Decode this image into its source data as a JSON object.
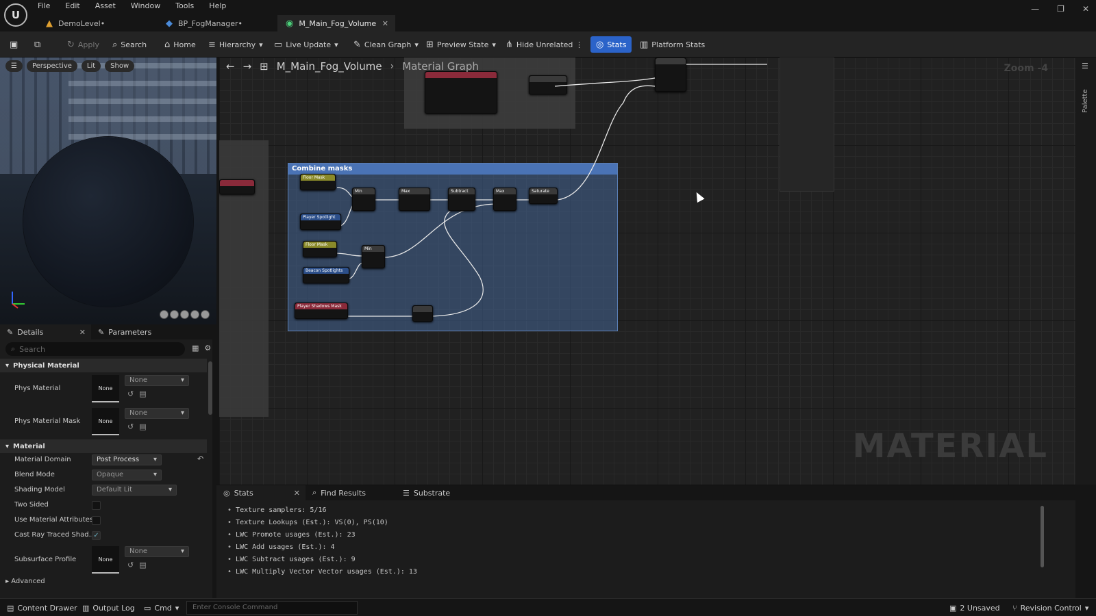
{
  "menu": [
    "File",
    "Edit",
    "Asset",
    "Window",
    "Tools",
    "Help"
  ],
  "tabs": [
    {
      "label": "DemoLevel•",
      "icon": "level-icon"
    },
    {
      "label": "BP_FogManager•",
      "icon": "blueprint-icon"
    },
    {
      "label": "M_Main_Fog_Volume",
      "icon": "material-icon"
    }
  ],
  "toolbar": {
    "apply": "Apply",
    "search": "Search",
    "home": "Home",
    "hierarchy": "Hierarchy",
    "live_update": "Live Update",
    "clean_graph": "Clean Graph",
    "preview_state": "Preview State",
    "hide_unrelated": "Hide Unrelated",
    "stats": "Stats",
    "platform_stats": "Platform Stats"
  },
  "viewport": {
    "perspective": "Perspective",
    "lit": "Lit",
    "show": "Show"
  },
  "details": {
    "tab_details": "Details",
    "tab_parameters": "Parameters",
    "search_placeholder": "Search",
    "section_physical": "Physical Material",
    "section_material": "Material",
    "advanced": "Advanced",
    "phys_material": "Phys Material",
    "phys_material_mask": "Phys Material Mask",
    "none": "None",
    "material_domain": "Material Domain",
    "material_domain_value": "Post Process",
    "blend_mode": "Blend Mode",
    "blend_mode_value": "Opaque",
    "shading_model": "Shading Model",
    "shading_model_value": "Default Lit",
    "two_sided": "Two Sided",
    "use_material_attributes": "Use Material Attributes",
    "cast_ray": "Cast Ray Traced Shad...",
    "subsurface_profile": "Subsurface Profile"
  },
  "graph": {
    "breadcrumb_asset": "M_Main_Fog_Volume",
    "breadcrumb_graph": "Material Graph",
    "zoom": "Zoom -4",
    "palette": "Palette",
    "watermark": "MATERIAL",
    "comment_title": "Combine masks",
    "nodes": [
      {
        "title": "Floor Mask",
        "color": "#8a8a2a"
      },
      {
        "title": "Player Spotlight",
        "color": "#2c4f8a"
      },
      {
        "title": "Floor Mask",
        "color": "#8a8a2a"
      },
      {
        "title": "Beacon Spotlights",
        "color": "#2c4f8a"
      },
      {
        "title": "Player Shadows Mask",
        "color": "#8a2a3a"
      },
      {
        "title": "Min",
        "color": "#3a3a3a"
      },
      {
        "title": "Min",
        "color": "#3a3a3a"
      },
      {
        "title": "Max",
        "color": "#3a3a3a"
      },
      {
        "title": "Subtract",
        "color": "#3a3a3a"
      },
      {
        "title": "Max",
        "color": "#3a3a3a"
      },
      {
        "title": "Saturate",
        "color": "#3a3a3a"
      }
    ]
  },
  "stats_panel": {
    "tab_stats": "Stats",
    "tab_find": "Find Results",
    "tab_substrate": "Substrate",
    "lines": [
      "Texture samplers: 5/16",
      "Texture Lookups (Est.): VS(0), PS(10)",
      "LWC Promote usages (Est.): 23",
      "LWC Add usages (Est.): 4",
      "LWC Subtract usages (Est.): 9",
      "LWC Multiply Vector Vector usages (Est.): 13"
    ]
  },
  "statusbar": {
    "content_drawer": "Content Drawer",
    "output_log": "Output Log",
    "cmd": "Cmd",
    "console_placeholder": "Enter Console Command",
    "unsaved": "2 Unsaved",
    "revision": "Revision Control"
  }
}
